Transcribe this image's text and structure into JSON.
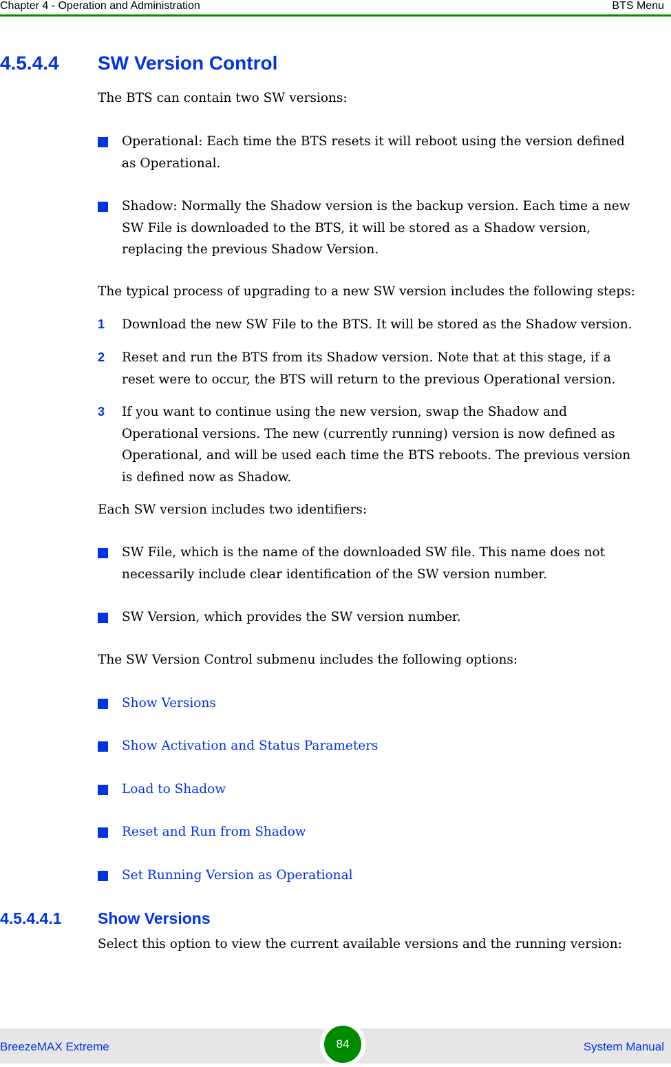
{
  "header": {
    "chapter": "Chapter 4 - Operation and Administration",
    "section": "BTS Menu"
  },
  "section": {
    "number": "4.5.4.4",
    "title": "SW Version Control"
  },
  "intro": "The BTS can contain two SW versions:",
  "version_types": [
    {
      "lines": [
        "Operational: Each time the BTS resets it will reboot using the version defined",
        "as Operational."
      ]
    },
    {
      "lines": [
        "Shadow: Normally the Shadow version is the backup version. Each time a new",
        "SW File is downloaded to the BTS, it will be stored as a Shadow version,",
        "replacing the previous Shadow Version."
      ]
    }
  ],
  "process_intro": "The typical process of upgrading to a new SW version includes the following steps:",
  "steps": [
    {
      "marker": "1",
      "lines": [
        "Download the new SW File to the BTS. It will be stored as the Shadow version."
      ]
    },
    {
      "marker": "2",
      "lines": [
        "Reset and run the BTS from its Shadow version. Note that at this stage, if a",
        "reset were to occur, the BTS will return to the previous Operational version."
      ]
    },
    {
      "marker": "3",
      "lines": [
        "If you want to continue using the new version, swap the Shadow and",
        "Operational versions. The new (currently running) version is now defined as",
        "Operational, and will be used each time the BTS reboots. The previous version",
        "is defined now as Shadow."
      ]
    }
  ],
  "identifiers_intro": "Each SW version includes two identifiers:",
  "identifiers": [
    {
      "lines": [
        "SW File, which is the name of the downloaded SW file. This name does not",
        "necessarily include clear identification of the SW version number."
      ]
    },
    {
      "lines": [
        "SW Version, which provides the SW version number."
      ]
    }
  ],
  "submenu_intro": "The SW Version Control submenu includes the following options:",
  "submenu_options": [
    "Show Versions",
    "Show Activation and Status Parameters",
    "Load to Shadow",
    "Reset and Run from Shadow",
    "Set Running Version as Operational"
  ],
  "subsection": {
    "number": "4.5.4.4.1",
    "title": "Show Versions",
    "body": "Select this option to view the current available versions and the running version:"
  },
  "footer": {
    "product": "BreezeMAX Extreme",
    "page": "84",
    "manual": "System Manual"
  },
  "colors": {
    "accent_blue": "#0033e6",
    "accent_green": "#008a00",
    "footer_bg": "#e6e6e6"
  }
}
